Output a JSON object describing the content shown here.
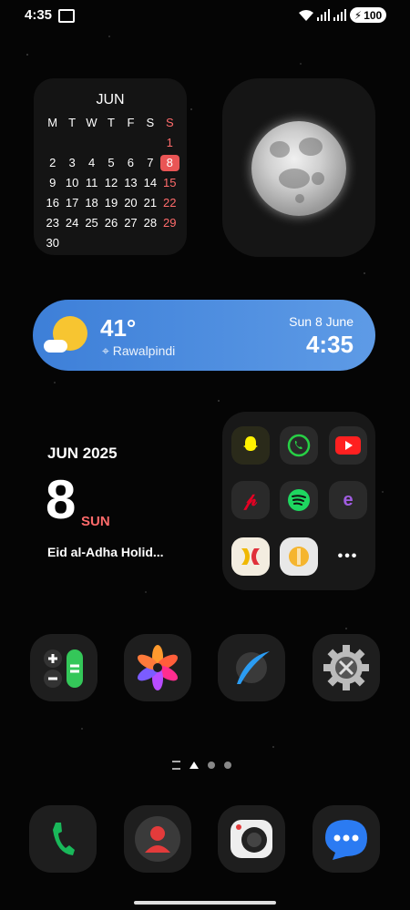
{
  "status_bar": {
    "time": "4:35",
    "battery": "100"
  },
  "calendar": {
    "month": "JUN",
    "weekdays": [
      "M",
      "T",
      "W",
      "T",
      "F",
      "S",
      "S"
    ],
    "rows": [
      [
        "",
        "",
        "",
        "",
        "",
        "",
        "1"
      ],
      [
        "2",
        "3",
        "4",
        "5",
        "6",
        "7",
        "8"
      ],
      [
        "9",
        "10",
        "11",
        "12",
        "13",
        "14",
        "15"
      ],
      [
        "16",
        "17",
        "18",
        "19",
        "20",
        "21",
        "22"
      ],
      [
        "23",
        "24",
        "25",
        "26",
        "27",
        "28",
        "29"
      ],
      [
        "30",
        "",
        "",
        "",
        "",
        "",
        ""
      ]
    ],
    "today": "8"
  },
  "weather": {
    "temp": "41°",
    "location": "Rawalpindi",
    "date": "Sun 8 June",
    "time": "4:35"
  },
  "date_widget": {
    "month_year": "JUN 2025",
    "day_num": "8",
    "day_name": "SUN",
    "event": "Eid al-Adha Holid..."
  },
  "folder": {
    "apps": [
      "snapchat",
      "whatsapp",
      "youtube",
      "pinterest",
      "spotify",
      "app-e",
      "app-x",
      "app-coin"
    ],
    "more_label": "•••"
  },
  "colors": {
    "accent_red": "#e95555",
    "weather_blue": "#4a8ae0"
  }
}
